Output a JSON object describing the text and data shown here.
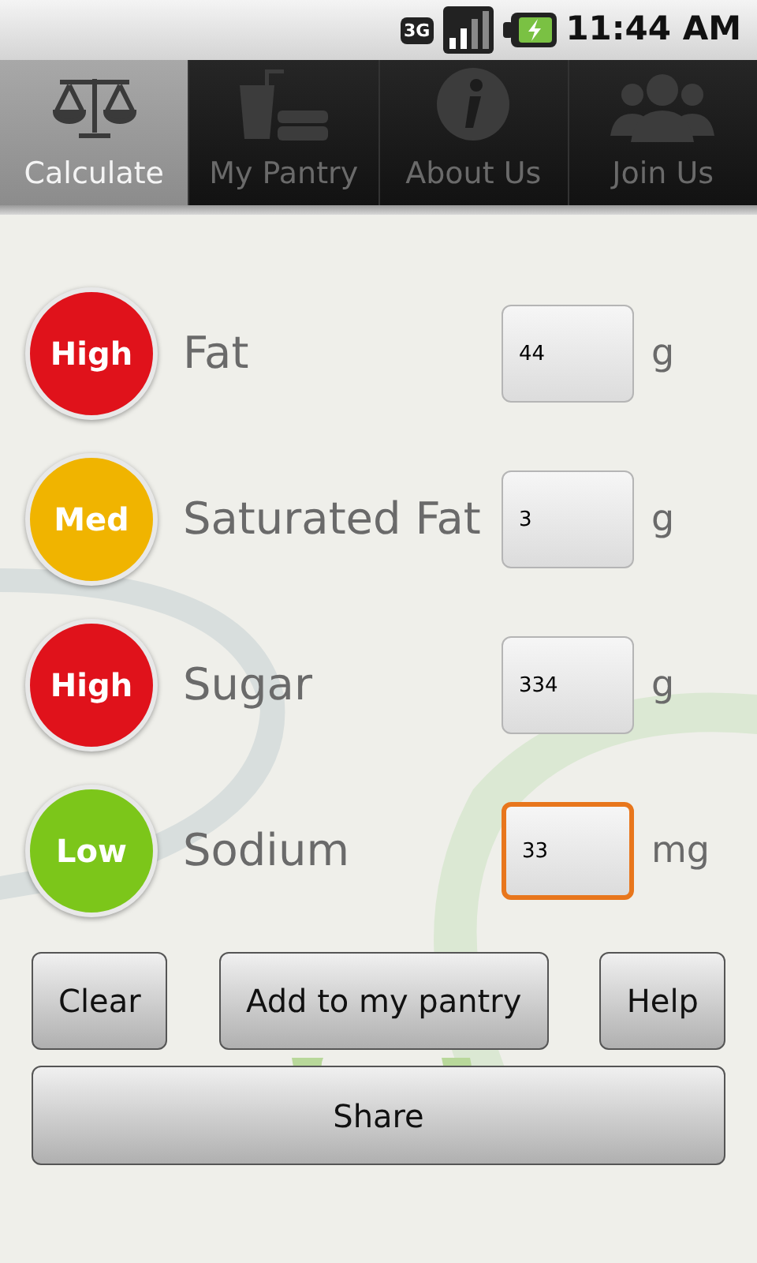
{
  "status_bar": {
    "network": "3G",
    "time": "11:44 AM"
  },
  "tabs": [
    {
      "label": "Calculate",
      "kind": "scale",
      "selected": true
    },
    {
      "label": "My Pantry",
      "kind": "pantry",
      "selected": false
    },
    {
      "label": "About Us",
      "kind": "info",
      "selected": false
    },
    {
      "label": "Join Us",
      "kind": "people",
      "selected": false
    }
  ],
  "nutrients": [
    {
      "badge": "High",
      "color": "#e0121b",
      "name": "Fat",
      "value": "44",
      "unit": "g",
      "focused": false
    },
    {
      "badge": "Med",
      "color": "#f0b400",
      "name": "Saturated Fat",
      "value": "3",
      "unit": "g",
      "focused": false
    },
    {
      "badge": "High",
      "color": "#e0121b",
      "name": "Sugar",
      "value": "334",
      "unit": "g",
      "focused": false
    },
    {
      "badge": "Low",
      "color": "#7cc61a",
      "name": "Sodium",
      "value": "33",
      "unit": "mg",
      "focused": true
    }
  ],
  "buttons": [
    "Clear",
    "Add to my pantry",
    "Help"
  ],
  "share_button": "Share"
}
